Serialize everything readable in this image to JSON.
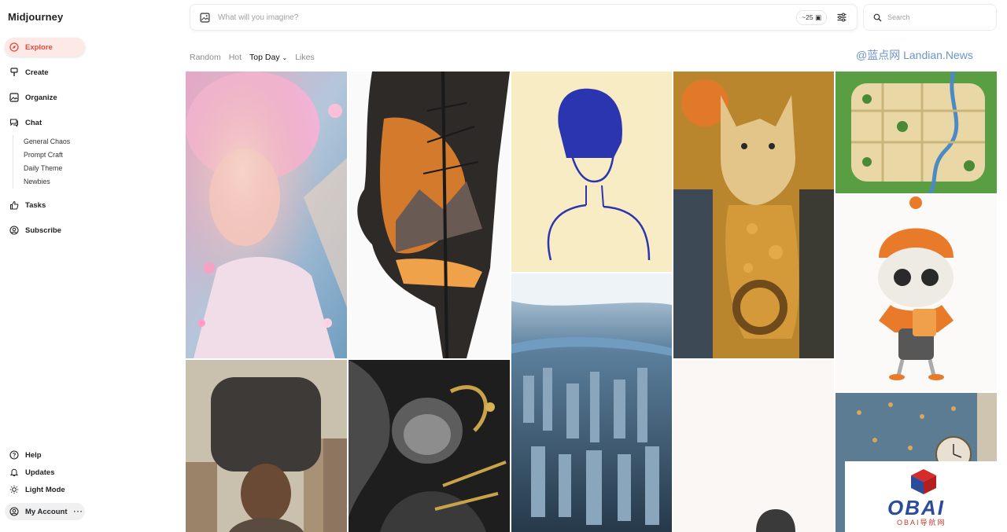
{
  "app": {
    "brand": "Midjourney"
  },
  "nav": {
    "explore": "Explore",
    "create": "Create",
    "organize": "Organize",
    "chat": "Chat",
    "chat_rooms": [
      "General Chaos",
      "Prompt Craft",
      "Daily Theme",
      "Newbies"
    ],
    "tasks": "Tasks",
    "subscribe": "Subscribe",
    "help": "Help",
    "updates": "Updates",
    "light_mode": "Light Mode",
    "my_account": "My Account",
    "more": "···"
  },
  "prompt": {
    "placeholder": "What will you imagine?",
    "credits": "~25"
  },
  "search": {
    "placeholder": "Search"
  },
  "filters": [
    "Random",
    "Hot",
    "Top Day",
    "Likes"
  ],
  "active_filter": "Top Day",
  "watermark": "@蓝点网 Landian.News",
  "badge": {
    "text": "OBAI",
    "subtext": "OBAI导航网"
  },
  "colors": {
    "accent": "#e5483d",
    "accent_bg": "#fde9e6"
  }
}
